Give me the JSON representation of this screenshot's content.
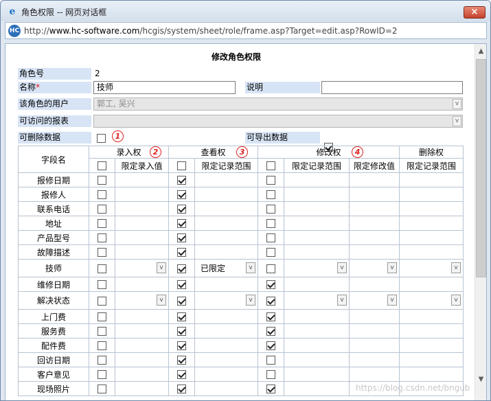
{
  "window": {
    "title": "角色权限 -- 网页对话框",
    "close_label": "×",
    "url_prefix": "http://",
    "url_domain": "www.hc-software.com",
    "url_path": "/hcgis/system/sheet/role/frame.asp?Target=edit.asp?RowID=2"
  },
  "form": {
    "title": "修改角色权限",
    "role_id_label": "角色号",
    "role_id_value": "2",
    "name_label": "名称",
    "required_mark": "*",
    "name_value": "技师",
    "desc_label": "说明",
    "desc_value": "",
    "users_label": "该角色的用户",
    "users_value": "郭工, 吴兴",
    "reports_label": "可访问的报表",
    "reports_value": "",
    "can_delete_label": "可删除数据",
    "can_delete_checked": false,
    "can_export_label": "可导出数据",
    "can_export_checked": true,
    "dropdown_glyph": "v"
  },
  "annotations": [
    "1",
    "2",
    "3",
    "4"
  ],
  "grid": {
    "field_header": "字段名",
    "groups": [
      "录入权",
      "查看权",
      "修改权",
      "删除权"
    ],
    "sub_headers": {
      "entry_limit": "限定录入值",
      "view_range": "限定记录范围",
      "modify_range": "限定记录范围",
      "modify_value": "限定修改值",
      "delete_range": "限定记录范围"
    },
    "rows": [
      {
        "name": "报修日期",
        "entry": false,
        "view": true,
        "modify": false
      },
      {
        "name": "报修人",
        "entry": false,
        "view": true,
        "modify": false
      },
      {
        "name": "联系电话",
        "entry": false,
        "view": true,
        "modify": false
      },
      {
        "name": "地址",
        "entry": false,
        "view": true,
        "modify": false
      },
      {
        "name": "产品型号",
        "entry": false,
        "view": true,
        "modify": false
      },
      {
        "name": "故障描述",
        "entry": false,
        "view": true,
        "modify": false
      },
      {
        "name": "技师",
        "entry": false,
        "view": true,
        "modify": false,
        "dropdowns": true,
        "view_range_text": "已限定"
      },
      {
        "name": "维修日期",
        "entry": false,
        "view": true,
        "modify": true
      },
      {
        "name": "解决状态",
        "entry": false,
        "view": true,
        "modify": true,
        "dropdowns": true,
        "view_range_text": ""
      },
      {
        "name": "上门费",
        "entry": false,
        "view": true,
        "modify": true
      },
      {
        "name": "服务费",
        "entry": false,
        "view": true,
        "modify": true
      },
      {
        "name": "配件费",
        "entry": false,
        "view": true,
        "modify": true
      },
      {
        "name": "回访日期",
        "entry": false,
        "view": true,
        "modify": false
      },
      {
        "name": "客户意见",
        "entry": false,
        "view": true,
        "modify": false
      },
      {
        "name": "现场照片",
        "entry": false,
        "view": true,
        "modify": true
      }
    ]
  },
  "watermark": "https://blog.csdn.net/bngub"
}
